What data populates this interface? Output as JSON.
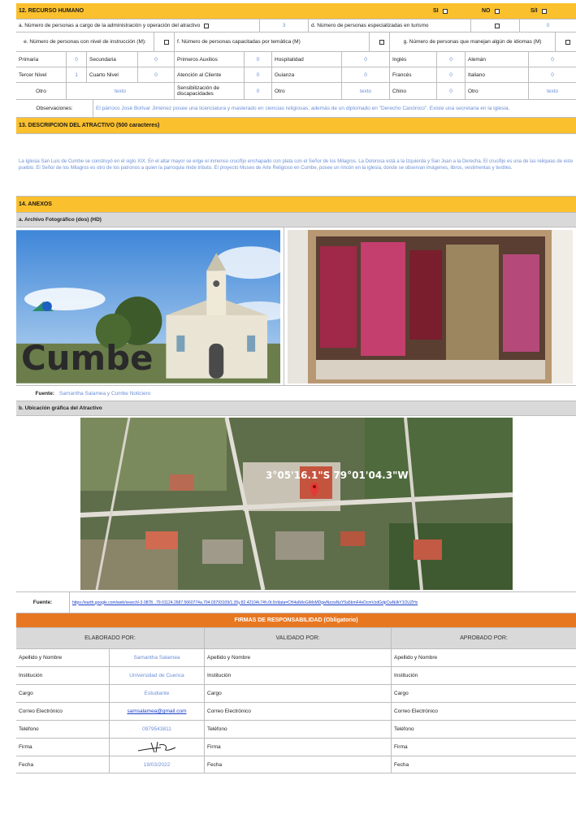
{
  "rh": {
    "title": "12. RECURSO HUMANO",
    "si": "SI",
    "no": "NO",
    "si_no": "S/I",
    "a_label": "a. Número de personas a cargo de la administración y operación del atractivo",
    "a_value": "3",
    "d_label": "d. Número de personas especializadas en turismo",
    "d_value": "0",
    "e_label": "e. Número de personas con nivel de instrucción (M):",
    "f_label": "f. Número de personas capacitadas por temática (M)",
    "g_label": "g. Número de personas que manejan algún de idiomas (M)",
    "edu": [
      {
        "l1": "Primaria",
        "v1": "0",
        "l2": "Secundaria",
        "v2": "0"
      },
      {
        "l1": "Tercer Nivel",
        "v1": "1",
        "l2": "Cuarto Nivel",
        "v2": "0"
      },
      {
        "l1": "Otro",
        "v1": "texto",
        "l2": "",
        "v2": ""
      }
    ],
    "cap": [
      {
        "l1": "Primeros Auxilios",
        "v1": "0",
        "l2": "Hospitalidad",
        "v2": "0"
      },
      {
        "l1": "Atención al Cliente",
        "v1": "0",
        "l2": "Guianza",
        "v2": "0"
      },
      {
        "l1": "Sensibilización de discapacidades",
        "v1": "0",
        "l2": "Otro",
        "v2": "texto"
      }
    ],
    "lang": [
      {
        "l1": "Inglés",
        "v1": "0",
        "l2": "Alemán",
        "v2": "0"
      },
      {
        "l1": "Francés",
        "v1": "0",
        "l2": "Italiano",
        "v2": "0"
      },
      {
        "l1": "Chino",
        "v1": "0",
        "l2": "Otro",
        "v2": "texto"
      }
    ],
    "obs_label": "Observaciones:",
    "obs_text": "El párroco José Bolívar Jiménez posee una licenciatura y masterado en ciencias religiosas; además de un diplomado en \"Derecho Canónico\". Existe una secretaria en la iglesia."
  },
  "desc": {
    "title": "13. DESCRIPCION DEL ATRACTIVO (500 caracteres)",
    "text": "La Iglesia San Luis de Cumbe se construyó en el siglo XIX. En el altar mayor se erige el inmenso crucifijo enchapado con plata con el Señor de los Milagros. La Dolorosa está a la Izquierda y San Juan a la Derecha. El crucifijo es una de las reliquias de este pueblo. El Señor de los Milagros es otro de los patronos a quien la parroquia rinde tributo. El proyecto Museo de Arte Religioso en Cumbe, posee un rincón en la iglesia, donde se observan imágenes, libros, vestimentas y textiles."
  },
  "anexos": {
    "title": "14. ANEXOS",
    "foto_title": "a. Archivo Fotográfico (dos) (HD)",
    "cumbe_sign": "Cumbe",
    "fuente_label": "Fuente:",
    "fuente_text": "Samantha Salamea y Cumbe Noticiero",
    "map_title": "b. Ubicación gráfica del Atractivo",
    "map_coords": "3°05'16.1\"S 79°01'04.3\"W",
    "map_fuente_label": "Fuente:",
    "map_url": "https://earth.google.com/web/search/-3.0878...79.01124.2687.5660774a.794.03793109/1.35y.82.42104t.74h.0t.0r/data=CH4aNiIoGiMxMDgwNzcwNzY5a5bmF4eDcmVzdGdpCwNiIkY1OUZHx"
  },
  "firmas": {
    "title": "FIRMAS DE RESPONSABILIDAD (Obligatorio)",
    "elab": "ELABORADO POR:",
    "valid": "VALIDADO POR:",
    "aprob": "APROBADO POR:",
    "rows": [
      {
        "label": "Apellido y Nombre",
        "value": "Samantha Salamea"
      },
      {
        "label": "Institución",
        "value": "Universidad de Cuenca"
      },
      {
        "label": "Cargo",
        "value": "Estudiante"
      },
      {
        "label": "Correo Electrónico",
        "value": "samsalamea@gmail.com"
      },
      {
        "label": "Teléfono",
        "value": "0979543811"
      },
      {
        "label": "Firma",
        "value": ""
      },
      {
        "label": "Fecha",
        "value": "19/03/2022"
      }
    ]
  },
  "colors": {
    "orange": "#fbc02d",
    "band": "#e87722",
    "blue_text": "#6b8fd6"
  }
}
